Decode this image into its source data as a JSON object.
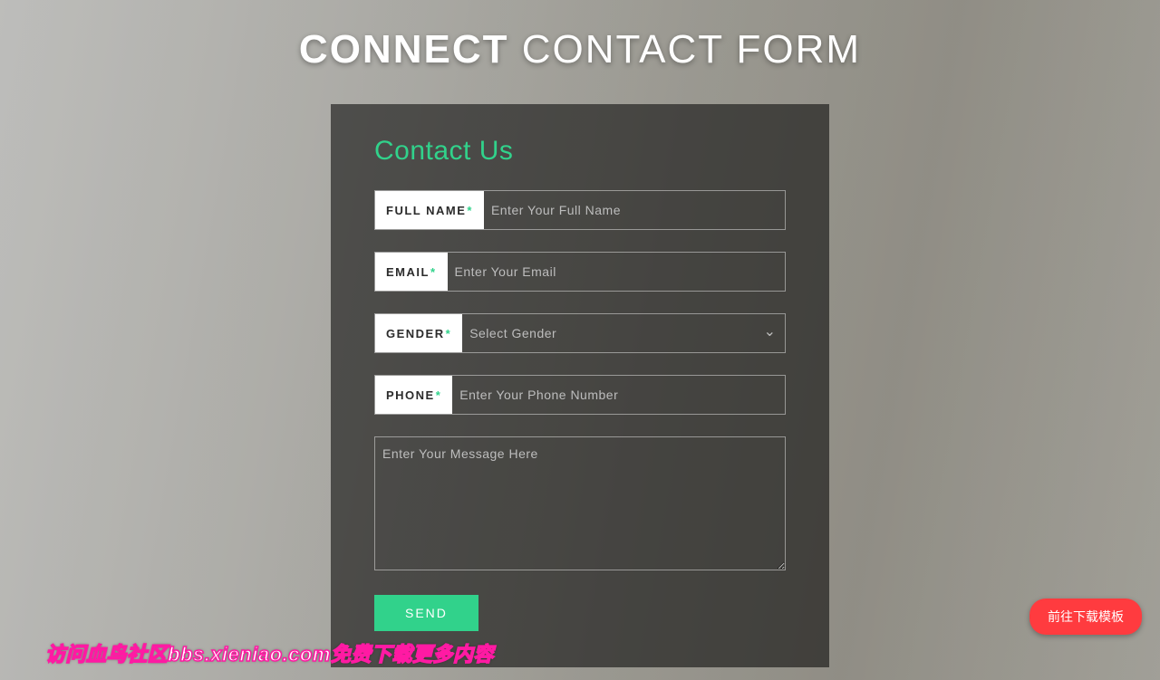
{
  "header": {
    "title_bold": "CONNECT",
    "title_rest": " CONTACT FORM"
  },
  "card": {
    "heading": "Contact Us",
    "fields": {
      "fullname": {
        "label": "FULL NAME",
        "placeholder": "Enter Your Full Name",
        "required_mark": "*"
      },
      "email": {
        "label": "EMAIL",
        "placeholder": "Enter Your Email",
        "required_mark": "*"
      },
      "gender": {
        "label": "GENDER",
        "placeholder": "Select Gender",
        "required_mark": "*"
      },
      "phone": {
        "label": "PHONE",
        "placeholder": "Enter Your Phone Number",
        "required_mark": "*"
      },
      "message": {
        "placeholder": "Enter Your Message Here"
      }
    },
    "submit_label": "SEND"
  },
  "floating_button": {
    "label": "前往下载模板"
  },
  "watermark": {
    "text": "访问血鸟社区bbs.xieniao.com免费下载更多内容"
  },
  "colors": {
    "accent": "#31d28b",
    "danger": "#ff3b3f",
    "watermark_stroke": "#ff1aa3"
  }
}
